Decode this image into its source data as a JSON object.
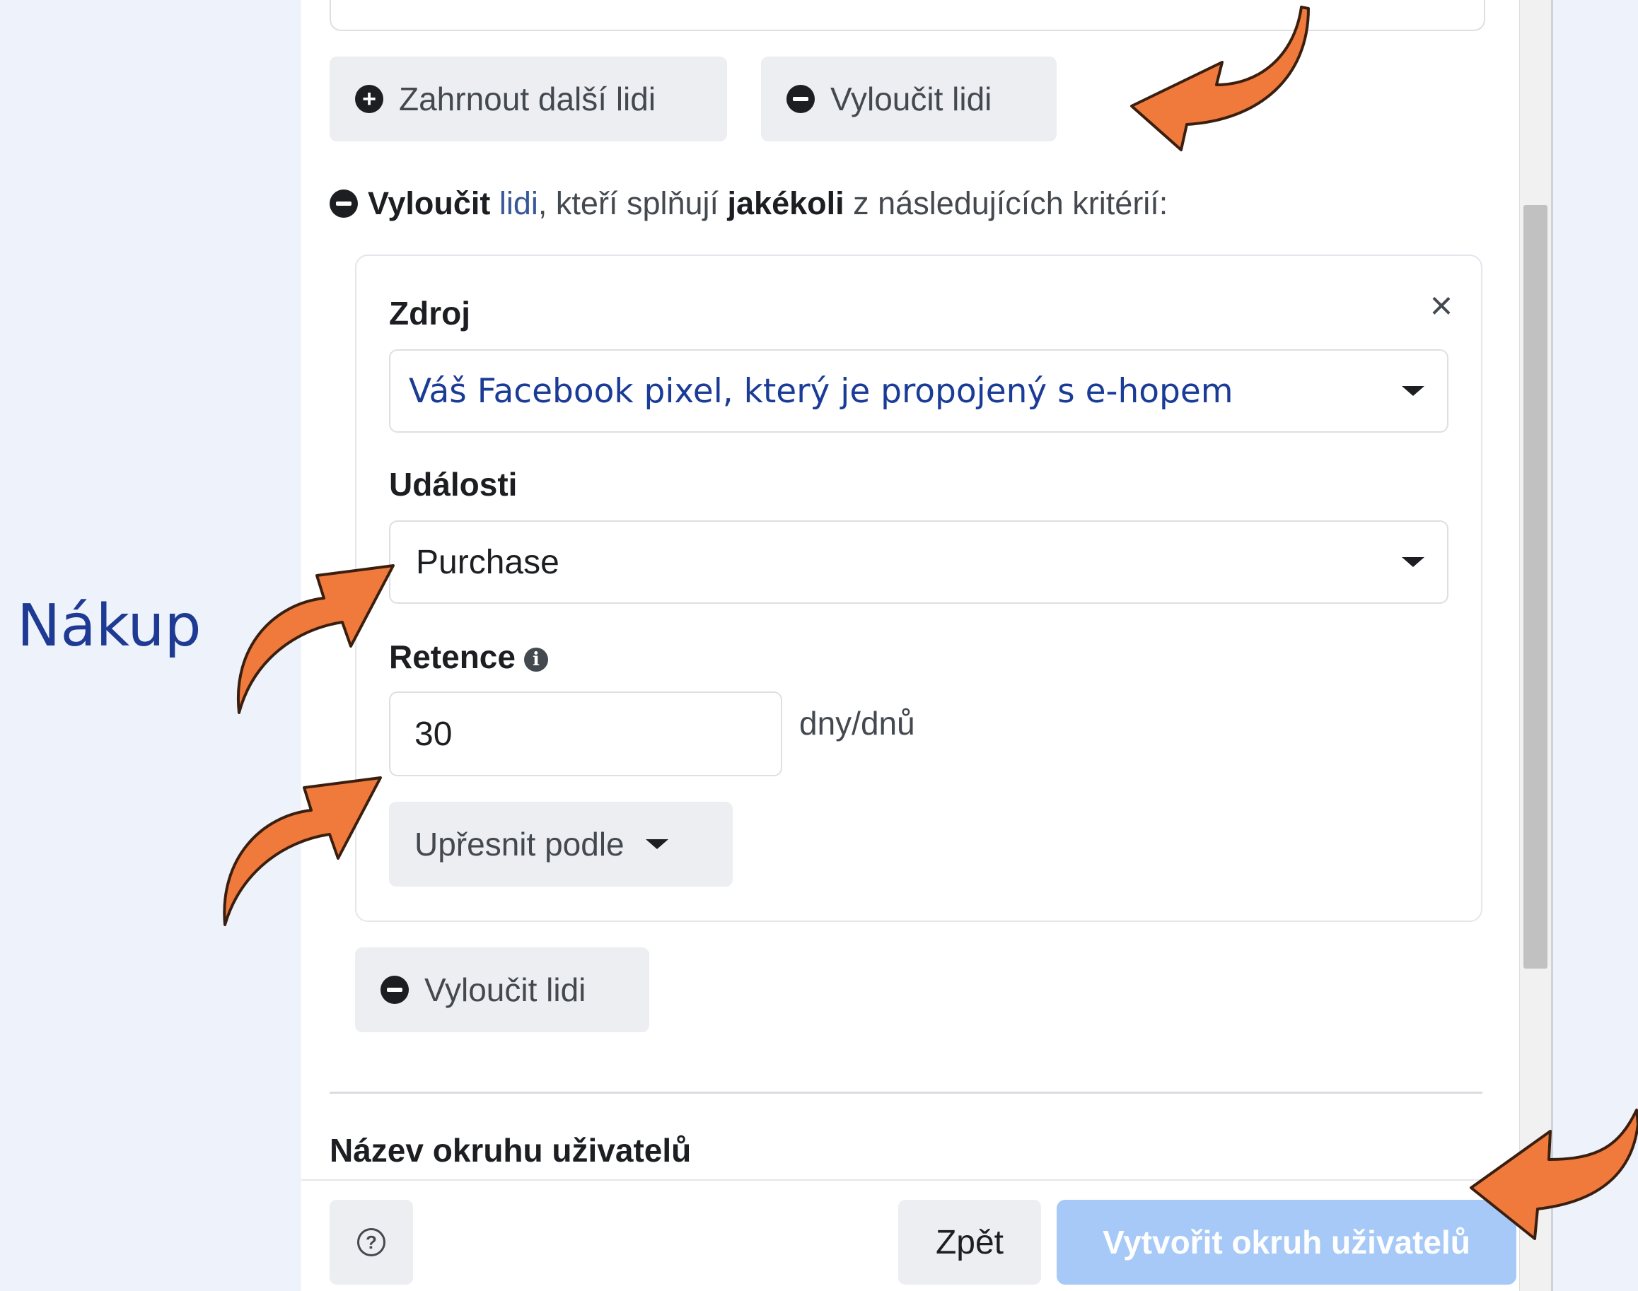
{
  "colors": {
    "page_background": "#eef3fb",
    "panel": "#ffffff",
    "arrow_fill": "#f07a3c",
    "annotation_text": "#1f3a93",
    "primary_disabled": "#a7c9f7",
    "link": "#385898"
  },
  "actions": {
    "include_more": "Zahrnout další lidi",
    "exclude_people": "Vyloučit lidi"
  },
  "exclude_rule": {
    "verb": "Vyloučit",
    "people_link": "lidi",
    "middle": ", kteří splňují ",
    "any": "jakékoli",
    "tail": " z následujících kritérií:"
  },
  "criteria": {
    "source_label": "Zdroj",
    "source_value": "Váš Facebook pixel, který je propojený s e-hopem",
    "events_label": "Události",
    "events_value": "Purchase",
    "retention_label": "Retence",
    "retention_value": "30",
    "retention_unit": "dny/dnů",
    "refine_label": "Upřesnit podle"
  },
  "secondary_exclude": "Vyloučit lidi",
  "audience_name_label": "Název okruhu uživatelů",
  "footer": {
    "help_icon": "?",
    "back": "Zpět",
    "create": "Vytvořit okruh uživatelů"
  },
  "annotation": {
    "label": "Nákup"
  },
  "icons": {
    "plus": "plus-circle-icon",
    "minus": "minus-circle-icon",
    "close": "close-icon",
    "caret": "caret-down-icon",
    "info": "info-icon",
    "help": "help-circle-icon",
    "arrows": "hand-drawn-arrow-icon"
  }
}
